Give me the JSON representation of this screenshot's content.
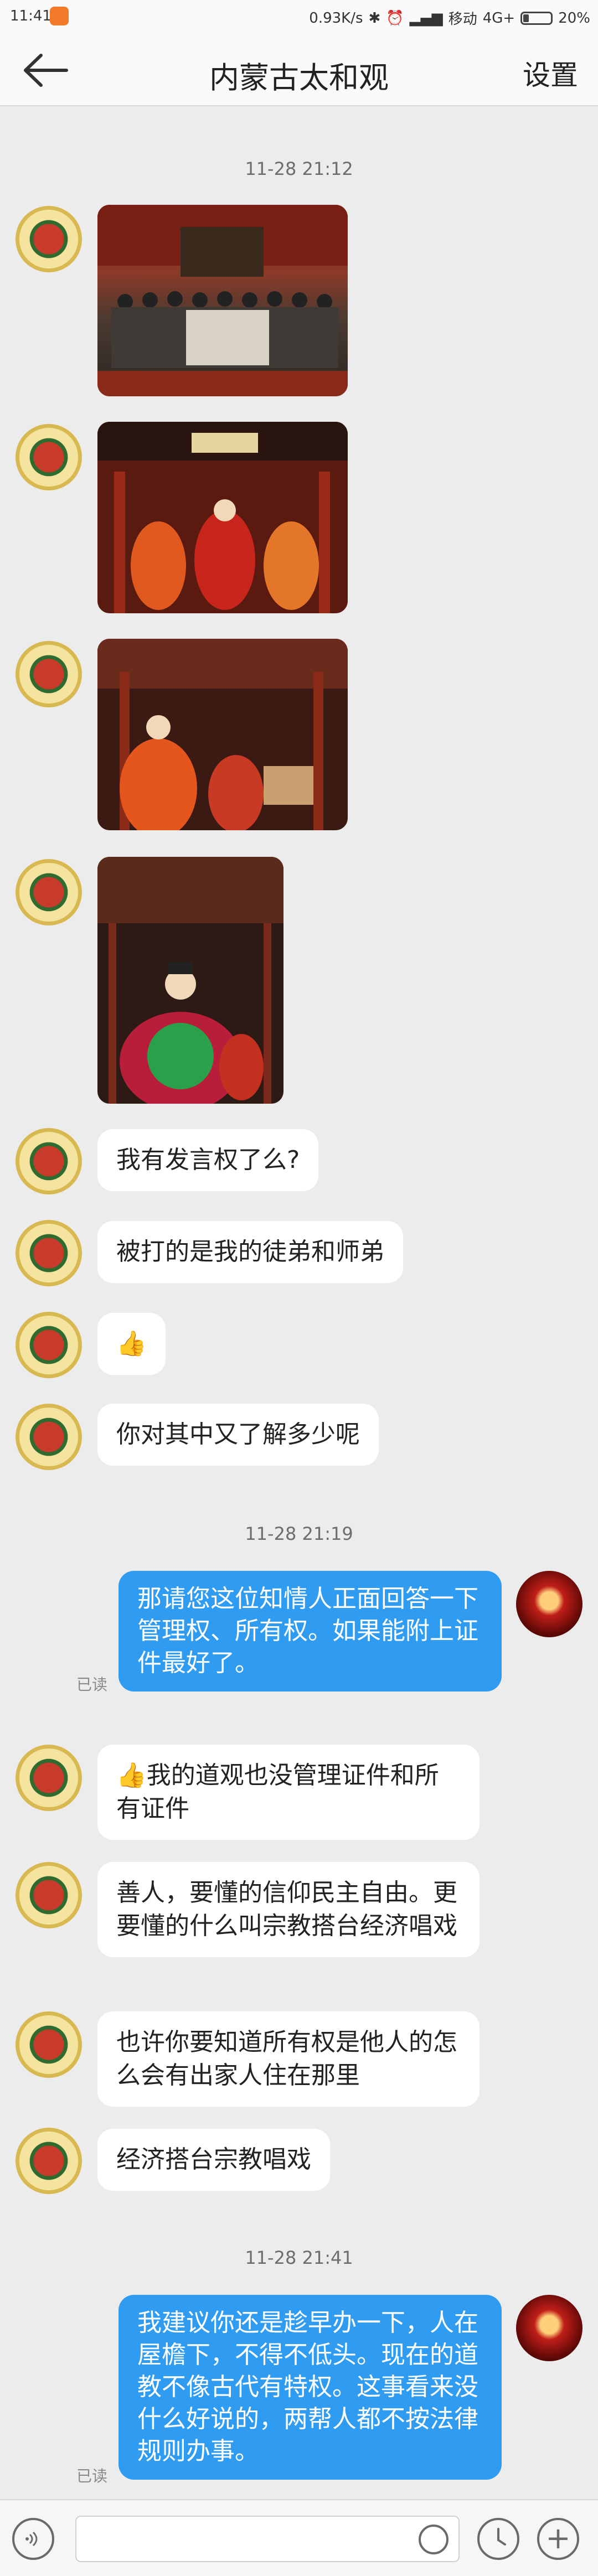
{
  "status_bar": {
    "time": "11:41",
    "network_speed": "0.93K/s",
    "carrier": "移动",
    "network_type": "4G+",
    "battery": "20%"
  },
  "header": {
    "title": "内蒙古太和观",
    "settings_label": "设置",
    "back_icon": "arrow-left-icon"
  },
  "messages": {
    "ts1": "11-28 21:12",
    "m5": "我有发言权了么?",
    "m6": "被打的是我的徒弟和师弟",
    "m7": "👍",
    "m8": "你对其中又了解多少呢",
    "ts2": "11-28 21:19",
    "o1": "那请您这位知情人正面回答一下管理权、所有权。如果能附上证件最好了。",
    "o1_read": "已读",
    "m9": "👍我的道观也没管理证件和所有证件",
    "m10": "善人，要懂的信仰民主自由。更要懂的什么叫宗教搭台经济唱戏",
    "m11": "也许你要知道所有权是他人的怎么会有出家人住在那里",
    "m12": "经济搭台宗教唱戏",
    "ts3": "11-28 21:41",
    "o2": "我建议你还是趁早办一下，人在屋檐下，不得不低头。现在的道教不像古代有特权。这事看来没什么好说的，两帮人都不按法律规则办事。",
    "o2_read": "已读"
  },
  "colors": {
    "outgoing_bubble": "#2f9cf1",
    "background": "#ececec"
  }
}
